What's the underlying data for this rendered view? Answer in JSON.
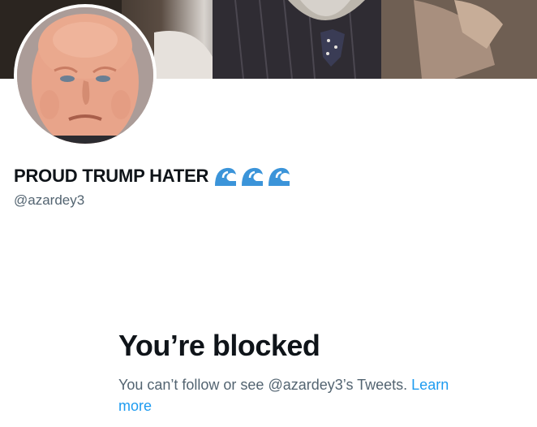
{
  "profile": {
    "display_name": "PROUD TRUMP HATER",
    "handle": "@azardey3",
    "name_emojis": [
      "wave-emoji",
      "wave-emoji",
      "wave-emoji"
    ]
  },
  "blocked": {
    "title": "You’re blocked",
    "message": "You can’t follow or see @azardey3’s Tweets.",
    "link_label": "Learn more"
  },
  "colors": {
    "text_primary": "#0f1419",
    "text_secondary": "#536471",
    "link": "#1d9bf0",
    "emoji_wave": "#3b94d9"
  }
}
